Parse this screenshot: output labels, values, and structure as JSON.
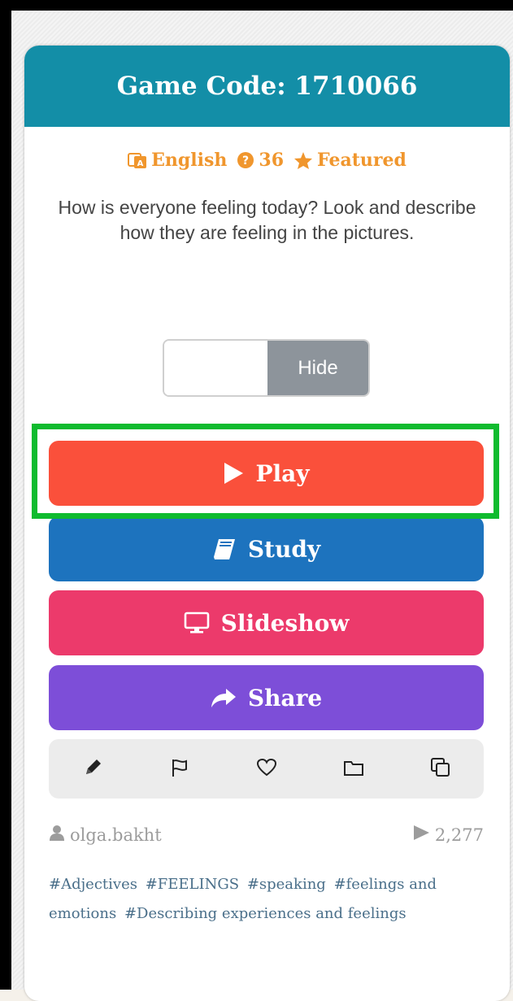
{
  "header": {
    "title": "Game Code: 1710066"
  },
  "meta": {
    "language": "English",
    "question_count": "36",
    "featured": "Featured"
  },
  "description": "How is everyone feeling today? Look and describe how they are feeling in the pictures.",
  "toggle": {
    "hide_label": "Hide"
  },
  "buttons": {
    "play": "Play",
    "study": "Study",
    "slideshow": "Slideshow",
    "share": "Share"
  },
  "toolbar": {
    "icons": [
      "pencil-icon",
      "flag-icon",
      "heart-icon",
      "folder-icon",
      "copy-icon"
    ]
  },
  "footer": {
    "author": "olga.bakht",
    "plays": "2,277"
  },
  "tags": [
    "#Adjectives",
    "#FEELINGS",
    "#speaking",
    "#feelings and emotions",
    "#Describing experiences and feelings"
  ],
  "colors": {
    "header": "#138ea7",
    "play": "#fa503b",
    "study": "#1d73be",
    "slideshow": "#ec3a6b",
    "share": "#7d4ed8",
    "highlight": "#0fbb2e",
    "meta": "#f0962d"
  }
}
